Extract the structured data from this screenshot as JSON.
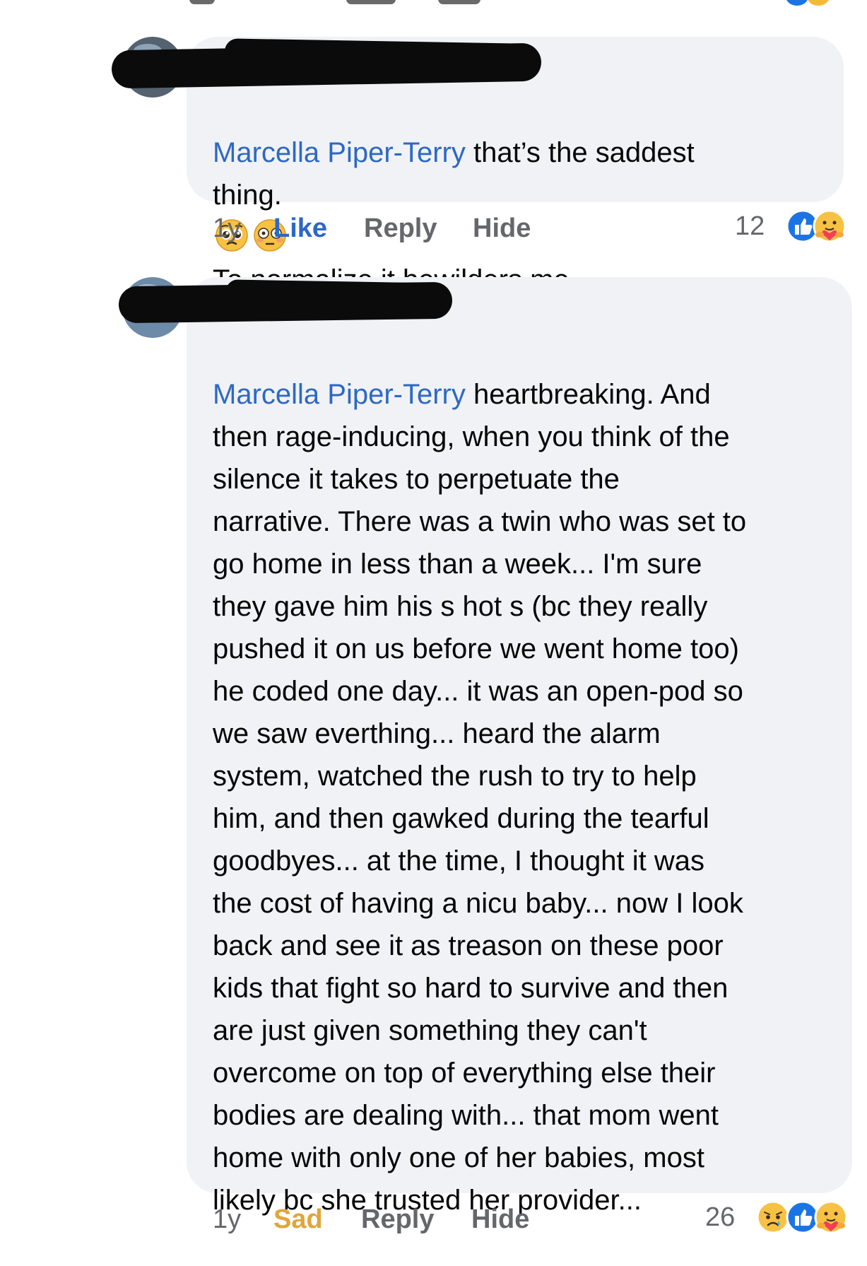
{
  "top_partial": {
    "description_hidden": true
  },
  "comments": [
    {
      "mention": "Marcella Piper-Terry",
      "text_before_emoji": " that’s the saddest\nthing.",
      "emojis": [
        "pleading-face-emoji",
        "flushed-face-emoji"
      ],
      "text_after_emoji": "To normalize it bewilders me.",
      "time": "1y",
      "reaction_action": "Like",
      "reply": "Reply",
      "hide": "Hide",
      "reaction_count": "12",
      "reaction_icons": [
        "like-icon",
        "care-icon"
      ]
    },
    {
      "mention": "Marcella Piper-Terry",
      "text": " heartbreaking. And\nthen rage-inducing, when you think of the\nsilence it takes to perpetuate the\nnarrative. There was a twin who was set to\ngo home in less than a week... I'm sure\nthey gave him his  s hot s (bc they really\npushed it on us before we went home too)\nhe coded one day... it was an open-pod so\nwe saw everthing... heard the alarm\nsystem, watched the rush to try to help\nhim, and then gawked during the tearful\ngoodbyes... at the time, I thought it was\nthe cost of having a nicu baby... now I look\nback and see it as treason on these poor\nkids that fight so hard to survive and then\nare just given something they can't\novercome on top of everything else their\nbodies are dealing with... that mom went\nhome with only one of her babies, most\nlikely bc she trusted her provider...",
      "time": "1y",
      "reaction_action": "Sad",
      "reply": "Reply",
      "hide": "Hide",
      "reaction_count": "26",
      "reaction_icons": [
        "sad-icon",
        "like-icon",
        "care-icon"
      ]
    }
  ],
  "colors": {
    "mention": "#2d68c4",
    "bubble": "#f0f2f5",
    "meta": "#65676b",
    "like_active": "#2d68c4",
    "sad_active": "#e0a63a",
    "like_blue": "#1b74e4",
    "emoji_yellow": "#f7c144"
  }
}
